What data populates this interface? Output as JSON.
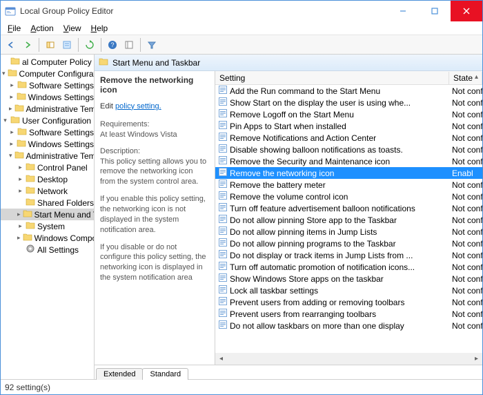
{
  "title": "Local Group Policy Editor",
  "menubar": [
    "File",
    "Action",
    "View",
    "Help"
  ],
  "header_band": "Start Menu and Taskbar",
  "tree": [
    {
      "depth": 1,
      "label": "al Computer Policy",
      "icon": "policy",
      "twisty": "none"
    },
    {
      "depth": 1,
      "label": "Computer Configuration",
      "icon": "computer",
      "twisty": "open"
    },
    {
      "depth": 2,
      "label": "Software Settings",
      "icon": "folder",
      "twisty": "closed"
    },
    {
      "depth": 2,
      "label": "Windows Settings",
      "icon": "folder",
      "twisty": "closed"
    },
    {
      "depth": 2,
      "label": "Administrative Templa",
      "icon": "folder",
      "twisty": "closed"
    },
    {
      "depth": 1,
      "label": "User Configuration",
      "icon": "user",
      "twisty": "open"
    },
    {
      "depth": 2,
      "label": "Software Settings",
      "icon": "folder",
      "twisty": "closed"
    },
    {
      "depth": 2,
      "label": "Windows Settings",
      "icon": "folder",
      "twisty": "closed"
    },
    {
      "depth": 2,
      "label": "Administrative Templa",
      "icon": "folder",
      "twisty": "open"
    },
    {
      "depth": 3,
      "label": "Control Panel",
      "icon": "folder",
      "twisty": "closed"
    },
    {
      "depth": 3,
      "label": "Desktop",
      "icon": "folder",
      "twisty": "closed"
    },
    {
      "depth": 3,
      "label": "Network",
      "icon": "folder",
      "twisty": "closed"
    },
    {
      "depth": 3,
      "label": "Shared Folders",
      "icon": "folder",
      "twisty": "none"
    },
    {
      "depth": 3,
      "label": "Start Menu and Ta",
      "icon": "folder",
      "twisty": "closed",
      "selected": true
    },
    {
      "depth": 3,
      "label": "System",
      "icon": "folder",
      "twisty": "closed"
    },
    {
      "depth": 3,
      "label": "Windows Compor",
      "icon": "folder",
      "twisty": "closed"
    },
    {
      "depth": 3,
      "label": "All Settings",
      "icon": "gear",
      "twisty": "none"
    }
  ],
  "desc": {
    "title": "Remove the networking icon",
    "edit_prefix": "Edit",
    "edit_link": "policy setting.",
    "req_label": "Requirements:",
    "req_text": "At least Windows Vista",
    "desc_label": "Description:",
    "desc_text1": "This policy setting allows you to remove the networking icon from the system control area.",
    "desc_text2": "If you enable this policy setting, the networking icon is not displayed in the system notification area.",
    "desc_text3": "If you disable or do not configure this policy setting, the networking icon is displayed in the system notification area"
  },
  "columns": {
    "setting": "Setting",
    "state": "State"
  },
  "rows": [
    {
      "name": "Add the Run command to the Start Menu",
      "state": "Not conf"
    },
    {
      "name": "Show Start on the display the user is using whe...",
      "state": "Not conf"
    },
    {
      "name": "Remove Logoff on the Start Menu",
      "state": "Not conf"
    },
    {
      "name": "Pin Apps to Start when installed",
      "state": "Not conf"
    },
    {
      "name": "Remove Notifications and Action Center",
      "state": "Not conf"
    },
    {
      "name": "Disable showing balloon notifications as toasts.",
      "state": "Not conf"
    },
    {
      "name": "Remove the Security and Maintenance icon",
      "state": "Not conf"
    },
    {
      "name": "Remove the networking icon",
      "state": "Enabl",
      "selected": true
    },
    {
      "name": "Remove the battery meter",
      "state": "Not conf"
    },
    {
      "name": "Remove the volume control icon",
      "state": "Not conf"
    },
    {
      "name": "Turn off feature advertisement balloon notifications",
      "state": "Not conf"
    },
    {
      "name": "Do not allow pinning Store app to the Taskbar",
      "state": "Not conf"
    },
    {
      "name": "Do not allow pinning items in Jump Lists",
      "state": "Not conf"
    },
    {
      "name": "Do not allow pinning programs to the Taskbar",
      "state": "Not conf"
    },
    {
      "name": "Do not display or track items in Jump Lists from ...",
      "state": "Not conf"
    },
    {
      "name": "Turn off automatic promotion of notification icons...",
      "state": "Not conf"
    },
    {
      "name": "Show Windows Store apps on the taskbar",
      "state": "Not conf"
    },
    {
      "name": "Lock all taskbar settings",
      "state": "Not conf"
    },
    {
      "name": "Prevent users from adding or removing toolbars",
      "state": "Not conf"
    },
    {
      "name": "Prevent users from rearranging toolbars",
      "state": "Not conf"
    },
    {
      "name": "Do not allow taskbars on more than one display",
      "state": "Not conf"
    }
  ],
  "tabs": {
    "extended": "Extended",
    "standard": "Standard"
  },
  "status": "92 setting(s)"
}
